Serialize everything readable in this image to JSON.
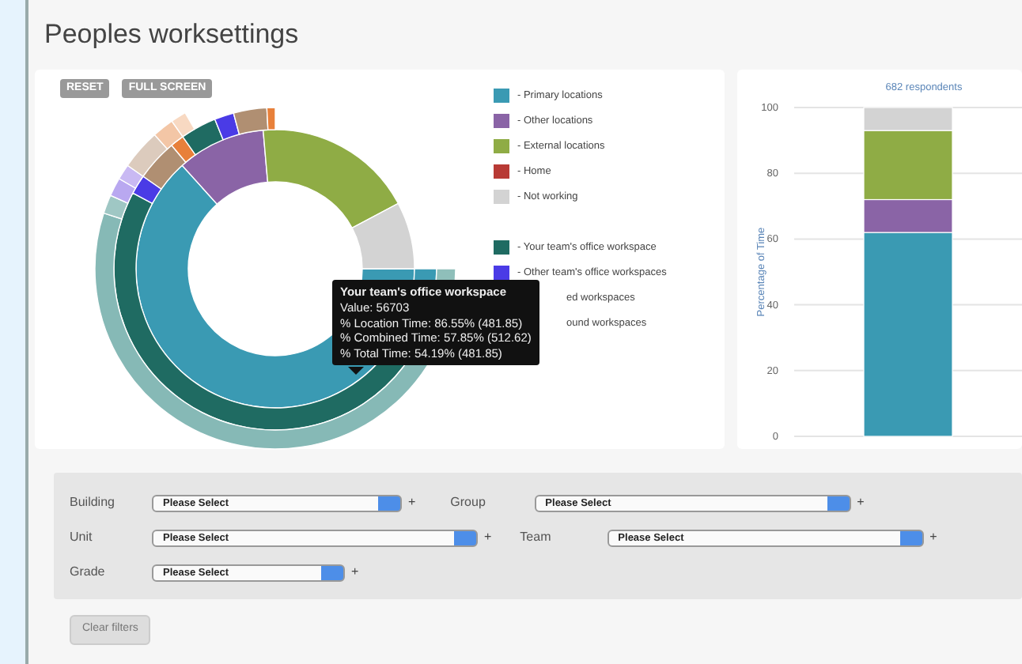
{
  "title": "Peoples worksettings",
  "chart_buttons": [
    "RESET",
    "FULL SCREEN"
  ],
  "legend": [
    {
      "label": "- Primary locations",
      "color": "#3a9ab3",
      "kind": "full"
    },
    {
      "label": "- Other locations",
      "color": "#8a64a6",
      "kind": "full"
    },
    {
      "label": "- External locations",
      "color": "#8fac45",
      "kind": "full"
    },
    {
      "label": "- Home",
      "color": "#b83a35",
      "kind": "full"
    },
    {
      "label": "- Not working",
      "color": "#d3d3d3",
      "kind": "full"
    },
    {
      "label": "- Your team's office workspace",
      "color": "#1f6b62",
      "kind": "gap"
    },
    {
      "label": "- Other team's office workspaces",
      "color": "#4a3be6",
      "kind": "full"
    },
    {
      "label": "ed workspaces",
      "kind": "covered"
    },
    {
      "label": "ound workspaces",
      "kind": "covered"
    }
  ],
  "tooltip": {
    "title": "Your team's office workspace",
    "lines": [
      "Value: 56703",
      "% Location Time: 86.55% (481.85)",
      "% Combined Time: 57.85% (512.62)",
      "% Total Time: 54.19% (481.85)"
    ]
  },
  "bar_chart": {
    "chart_data": {
      "type": "bar",
      "title": "682 respondents",
      "ylabel": "Percentage of Time",
      "stacked": true,
      "grid": true,
      "ylim": [
        0,
        100
      ],
      "yticks": [
        0,
        20,
        40,
        60,
        80,
        100
      ],
      "series": [
        {
          "color": "#3a9ab3",
          "values": [
            62
          ]
        },
        {
          "color": "#8a64a6",
          "values": [
            10
          ]
        },
        {
          "color": "#8fac45",
          "values": [
            21
          ]
        },
        {
          "color": "#d3d3d3",
          "values": [
            7
          ]
        }
      ]
    }
  },
  "filters": [
    [
      {
        "label": "Building",
        "value": "Please Select",
        "plus": "+"
      },
      {
        "label": "Group",
        "value": "Please Select",
        "plus": "+"
      }
    ],
    [
      {
        "label": "Unit",
        "value": "Please Select",
        "plus": "+"
      },
      {
        "label": "Team",
        "value": "Please Select",
        "plus": "+"
      }
    ],
    [
      {
        "label": "Grade",
        "value": "Please Select",
        "plus": "+"
      }
    ]
  ],
  "clear_button": "Clear filters"
}
